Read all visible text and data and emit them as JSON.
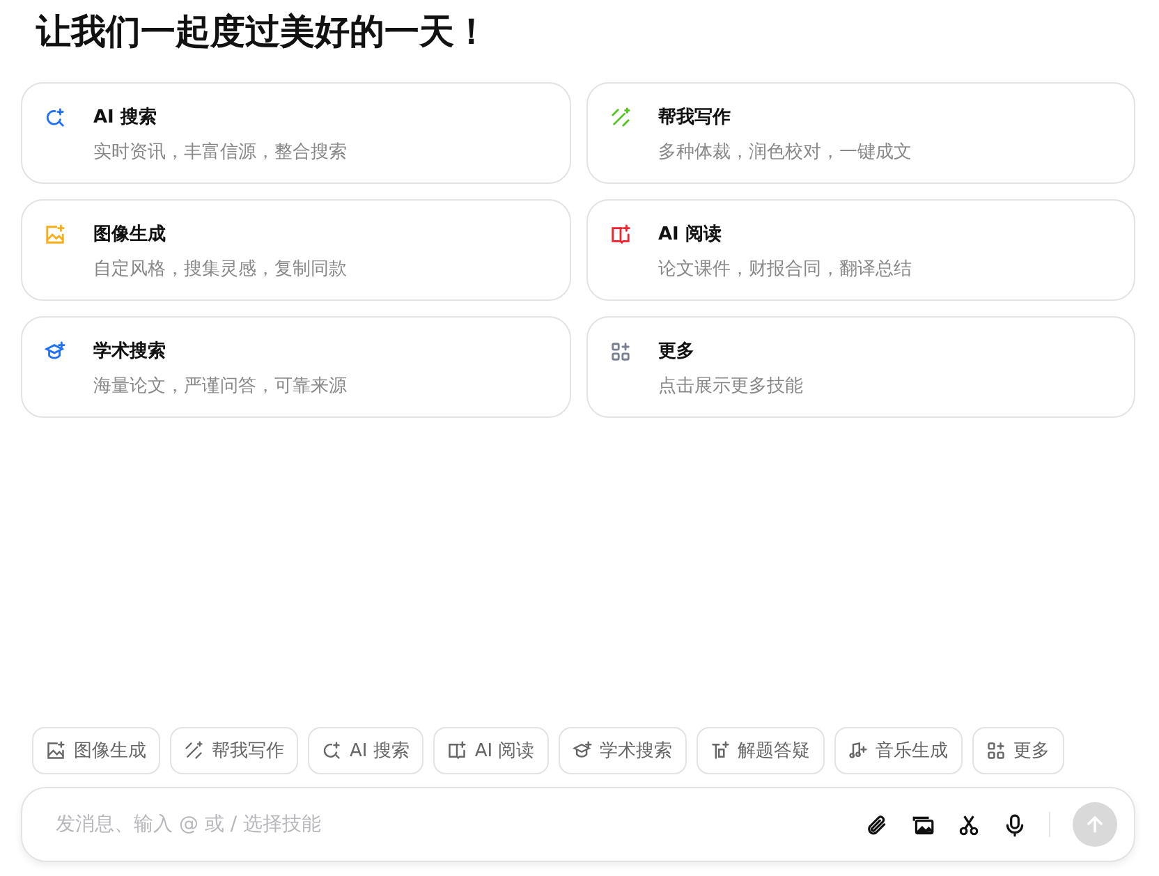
{
  "title": "让我们一起度过美好的一天！",
  "cards": [
    {
      "kind": "search",
      "color": "#1e6fff",
      "title": "AI 搜索",
      "subtitle": "实时资讯，丰富信源，整合搜索"
    },
    {
      "kind": "write",
      "color": "#52c41a",
      "title": "帮我写作",
      "subtitle": "多种体裁，润色校对，一键成文"
    },
    {
      "kind": "image",
      "color": "#faad14",
      "title": "图像生成",
      "subtitle": "自定风格，搜集灵感，复制同款"
    },
    {
      "kind": "read",
      "color": "#f5222d",
      "title": "AI 阅读",
      "subtitle": "论文课件，财报合同，翻译总结"
    },
    {
      "kind": "academic",
      "color": "#1e6fff",
      "title": "学术搜索",
      "subtitle": "海量论文，严谨问答，可靠来源"
    },
    {
      "kind": "more",
      "color": "#7a7f8f",
      "title": "更多",
      "subtitle": "点击展示更多技能"
    }
  ],
  "chips": [
    {
      "kind": "image",
      "label": "图像生成"
    },
    {
      "kind": "write",
      "label": "帮我写作"
    },
    {
      "kind": "search",
      "label": "AI 搜索"
    },
    {
      "kind": "read",
      "label": "AI 阅读"
    },
    {
      "kind": "academic",
      "label": "学术搜索"
    },
    {
      "kind": "qa",
      "label": "解题答疑"
    },
    {
      "kind": "music",
      "label": "音乐生成"
    },
    {
      "kind": "more",
      "label": "更多"
    }
  ],
  "input": {
    "placeholder": "发消息、输入 @ 或 / 选择技能"
  },
  "send_button": {
    "disabled": true
  }
}
